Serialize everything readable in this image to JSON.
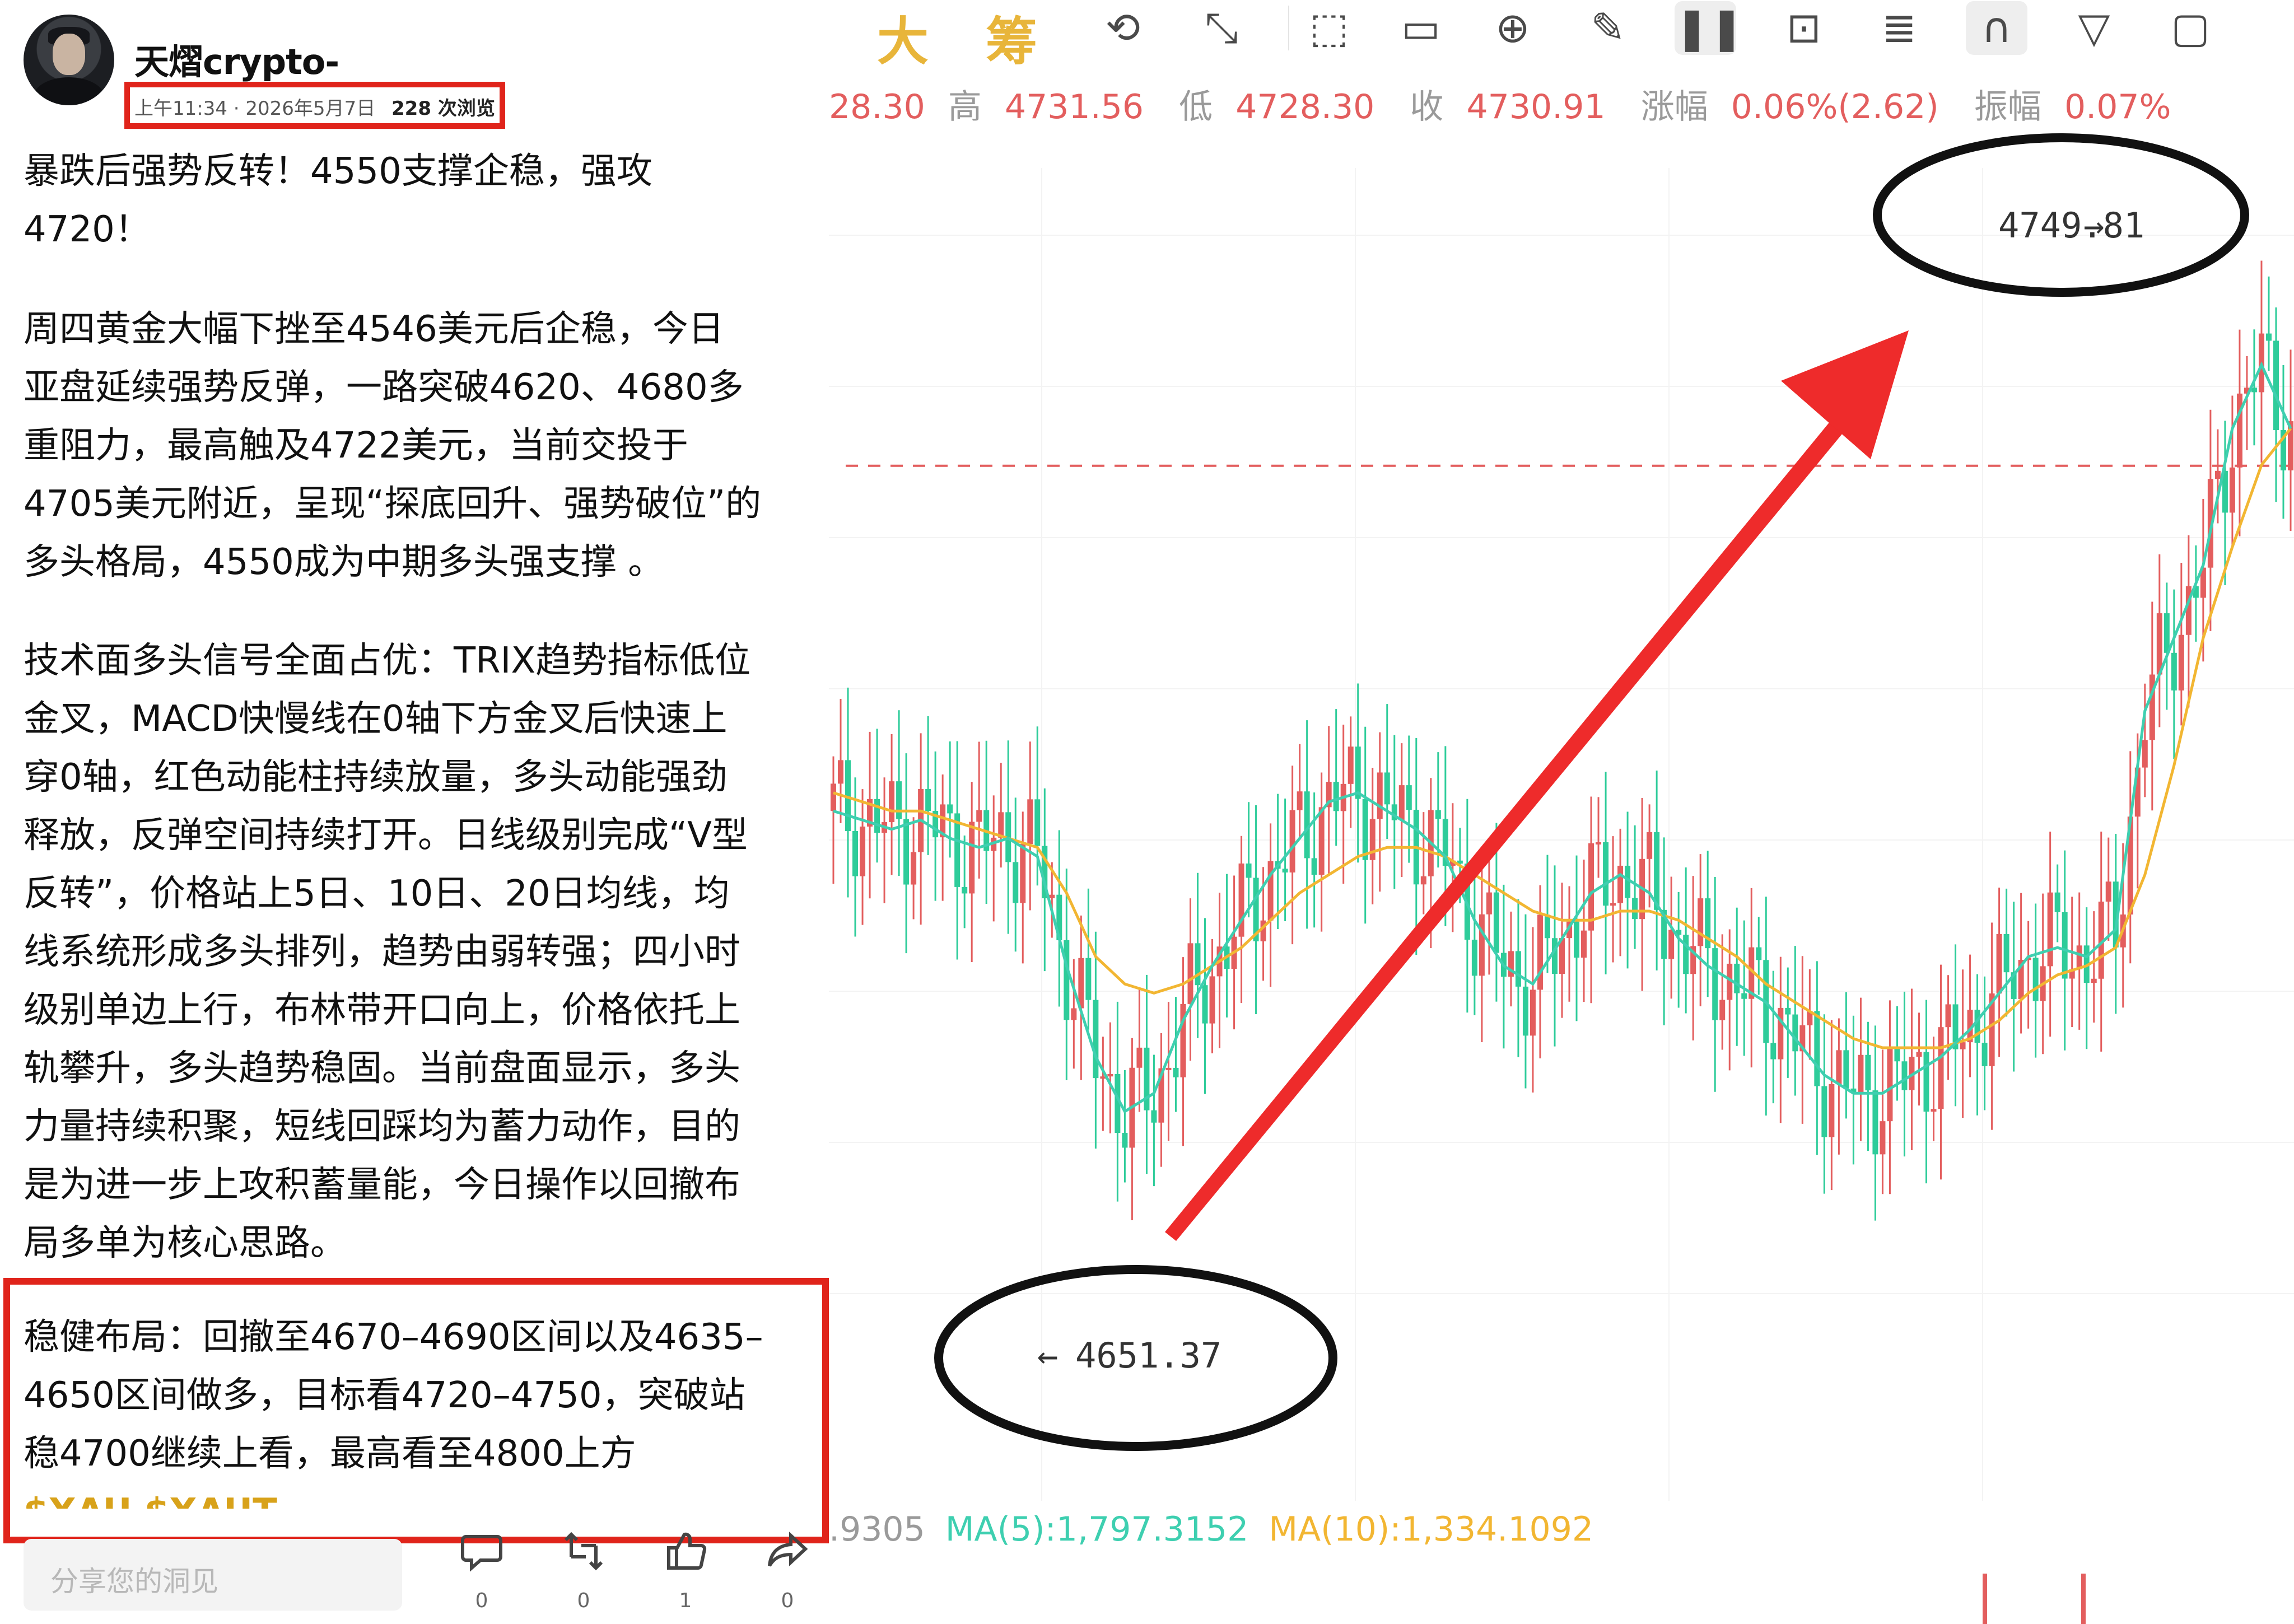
{
  "post": {
    "username": "天熠crypto-",
    "time": "上午11:34 · 2026年5月7日",
    "views": "228 次浏览",
    "paragraphs": [
      [
        "暴跌后强势反转！4550支撑企稳，强攻",
        "4720！"
      ],
      [
        "周四黄金大幅下挫至4546美元后企稳，今日",
        "亚盘延续强势反弹，一路突破4620、4680多",
        "重阻力，最高触及4722美元，当前交投于",
        "4705美元附近，呈现“探底回升、强势破位”的",
        "多头格局，4550成为中期多头强支撑 。"
      ],
      [
        "技术面多头信号全面占优：TRIX趋势指标低位",
        "金叉，MACD快慢线在0轴下方金叉后快速上",
        "穿0轴，红色动能柱持续放量，多头动能强劲",
        "释放，反弹空间持续打开。日线级别完成“V型",
        "反转”，价格站上5日、10日、20日均线，均",
        "线系统形成多头排列，趋势由弱转强；四小时",
        "级别单边上行，布林带开口向上，价格依托上",
        "轨攀升，多头趋势稳固。当前盘面显示，多头",
        "力量持续积聚，短线回踩均为蓄力动作，目的",
        "是为进一步上攻积蓄量能，今日操作以回撤布",
        "局多单为核心思路。"
      ],
      [
        "稳健布局：回撤至4670–4690区间以及4635–",
        "4650区间做多，目标看4720–4750，突破站",
        "稳4700继续上看，最高看至4800上方"
      ]
    ],
    "hashtags": "$XAU $XAUT",
    "comment_placeholder": "分享您的洞见",
    "actions": [
      {
        "icon": "comment-icon",
        "count": "0"
      },
      {
        "icon": "repost-icon",
        "count": "0"
      },
      {
        "icon": "like-icon",
        "count": "1"
      },
      {
        "icon": "share-icon",
        "count": "0"
      }
    ]
  },
  "chart": {
    "toolbar_chars": [
      "大",
      "筹"
    ],
    "toolbar_icons": [
      "draw-line-icon",
      "trend-tools-icon",
      "annotation-icon",
      "ruler-icon",
      "zoom-in-icon",
      "eraser-icon",
      "candlestick-icon",
      "lock-icon",
      "notes-icon",
      "magnet-icon",
      "filter-icon",
      "delete-icon"
    ],
    "ohlc": [
      {
        "label": "",
        "value": "28.30"
      },
      {
        "label": "高",
        "value": "4731.56"
      },
      {
        "label": "低",
        "value": "4728.30"
      },
      {
        "label": "收",
        "value": "4730.91"
      },
      {
        "label": "涨幅",
        "value": "0.06%(2.62)"
      },
      {
        "label": "振幅",
        "value": "0.07%"
      }
    ],
    "high_label": "4749.81",
    "low_label": "4651.37",
    "ma_row": {
      "prefix": ".9305",
      "ma5": "MA(5):1,797.3152",
      "ma10": "MA(10):1,334.1092"
    },
    "colors": {
      "up": "#e35e5e",
      "down": "#2ecc9a",
      "ma5": "#3ecfb0",
      "ma10": "#f2b632",
      "arrow": "#ee2b2b",
      "highlight": "#e0241b"
    }
  },
  "chart_data": {
    "type": "candlestick",
    "title": "",
    "xlabel": "",
    "ylabel": "",
    "ylim": [
      4640,
      4755
    ],
    "annotated_high": 4749.81,
    "annotated_low": 4651.37,
    "series": [
      {
        "name": "MA(5)",
        "values": [
          4693,
          4692,
          4691,
          4692,
          4690,
          4689,
          4690,
          4688,
          4676,
          4666,
          4660,
          4662,
          4670,
          4676,
          4681,
          4686,
          4690,
          4694,
          4695,
          4693,
          4691,
          4688,
          4681,
          4676,
          4674,
          4679,
          4684,
          4686,
          4684,
          4679,
          4676,
          4674,
          4672,
          4668,
          4664,
          4662,
          4662,
          4664,
          4666,
          4669,
          4673,
          4677,
          4678,
          4677,
          4680,
          4704,
          4712,
          4720,
          4735,
          4742,
          4735
        ]
      },
      {
        "name": "MA(10)",
        "values": [
          4695,
          4694,
          4693,
          4693,
          4692,
          4691,
          4690,
          4689,
          4684,
          4677,
          4674,
          4673,
          4674,
          4676,
          4678,
          4681,
          4684,
          4686,
          4688,
          4689,
          4689,
          4688,
          4686,
          4684,
          4682,
          4681,
          4681,
          4682,
          4682,
          4681,
          4679,
          4677,
          4674,
          4672,
          4670,
          4668,
          4667,
          4667,
          4667,
          4668,
          4670,
          4673,
          4675,
          4676,
          4678,
          4686,
          4698,
          4712,
          4722,
          4731,
          4735
        ]
      }
    ]
  }
}
